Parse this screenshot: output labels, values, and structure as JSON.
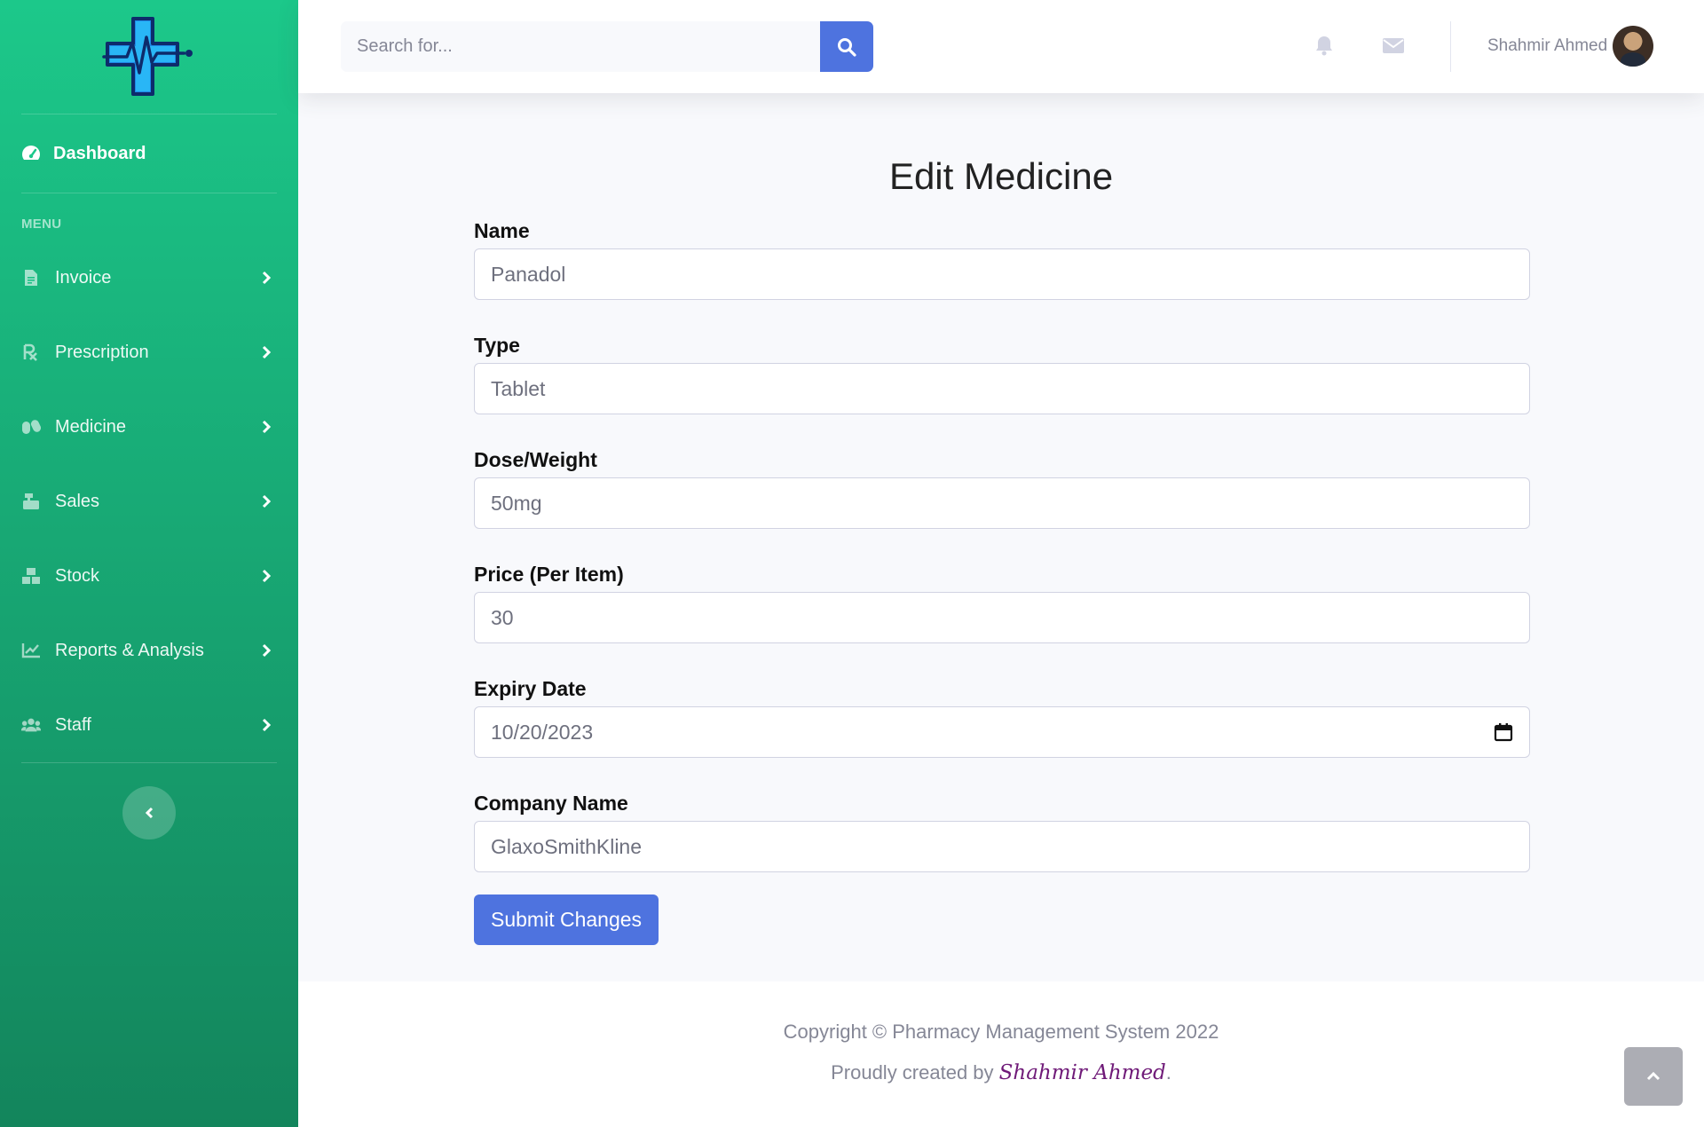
{
  "sidebar": {
    "dashboard_label": "Dashboard",
    "section_heading": "MENU",
    "items": [
      {
        "label": "Invoice",
        "icon": "file-invoice-icon"
      },
      {
        "label": "Prescription",
        "icon": "prescription-icon"
      },
      {
        "label": "Medicine",
        "icon": "capsules-icon"
      },
      {
        "label": "Sales",
        "icon": "cash-register-icon"
      },
      {
        "label": "Stock",
        "icon": "boxes-icon"
      },
      {
        "label": "Reports & Analysis",
        "icon": "chart-line-icon"
      },
      {
        "label": "Staff",
        "icon": "users-icon"
      }
    ],
    "colors": {
      "gradient_start": "#1cc88a",
      "gradient_end": "#13855c"
    }
  },
  "topbar": {
    "search": {
      "placeholder": "Search for..."
    },
    "user_name": "Shahmir Ahmed"
  },
  "main": {
    "title": "Edit Medicine",
    "fields": [
      {
        "label": "Name",
        "value": "Panadol"
      },
      {
        "label": "Type",
        "value": "Tablet"
      },
      {
        "label": "Dose/Weight",
        "value": "50mg"
      },
      {
        "label": "Price (Per Item)",
        "value": "30"
      },
      {
        "label": "Expiry Date",
        "value": "10/20/2023"
      },
      {
        "label": "Company Name",
        "value": "GlaxoSmithKline"
      }
    ],
    "submit_label": "Submit Changes"
  },
  "footer": {
    "copyright": "Copyright © Pharmacy Management System 2022",
    "credit_prefix": "Proudly created by ",
    "credit_author": "Shahmir Ahmed",
    "credit_suffix": "."
  },
  "colors": {
    "primary": "#4e73df",
    "text_muted": "#858796",
    "author": "#6f1a78"
  }
}
